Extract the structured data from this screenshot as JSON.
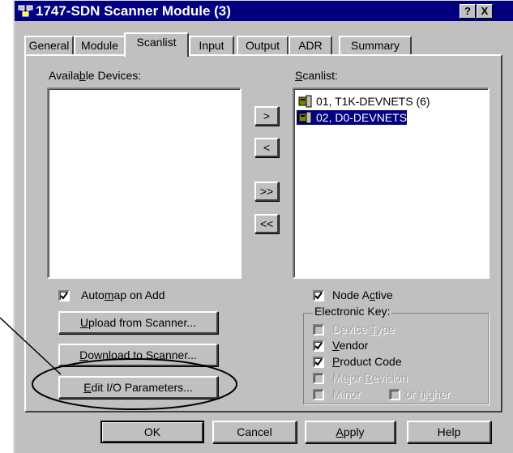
{
  "window": {
    "title": "1747-SDN Scanner Module (3)",
    "help_btn": "?",
    "close_btn": "X"
  },
  "tabs": [
    {
      "label": "General"
    },
    {
      "label": "Module"
    },
    {
      "label": "Scanlist",
      "active": true
    },
    {
      "label": "Input"
    },
    {
      "label": "Output"
    },
    {
      "label": "ADR"
    },
    {
      "label": "Summary"
    }
  ],
  "available": {
    "label_pre": "Availa",
    "label_u": "b",
    "label_post": "le Devices:"
  },
  "scanlist": {
    "label_u": "S",
    "label_post": "canlist:",
    "items": [
      "01, T1K-DEVNETS (6)",
      "02, D0-DEVNETS"
    ]
  },
  "transfer": {
    "add": ">",
    "remove": "<",
    "add_all": ">>",
    "remove_all": "<<"
  },
  "automap": {
    "pre": "Auto",
    "u": "m",
    "post": "ap on Add",
    "checked": true
  },
  "buttons": {
    "upload": {
      "u": "U",
      "post": "pload from Scanner..."
    },
    "download": {
      "u": "D",
      "post": "ownload to Scanner..."
    },
    "edit_io": {
      "u": "E",
      "post": "dit I/O Parameters..."
    }
  },
  "node_active": {
    "pre": "Node A",
    "u": "c",
    "post": "tive",
    "checked": true
  },
  "electronic_key": {
    "label": "Electronic Key:",
    "device_type": {
      "pre": "Device ",
      "u": "T",
      "post": "ype",
      "checked": false,
      "enabled": false
    },
    "vendor": {
      "pre": "",
      "u": "V",
      "post": "endor",
      "checked": true,
      "enabled": true
    },
    "product_code": {
      "pre": "",
      "u": "P",
      "post": "roduct Code",
      "checked": true,
      "enabled": true
    },
    "major_revision": {
      "pre": "Major ",
      "u": "R",
      "post": "evision",
      "checked": false,
      "enabled": false
    },
    "minor": {
      "text": "Minor",
      "checked": false,
      "enabled": false
    },
    "or_higher": {
      "pre": "or ",
      "u": "h",
      "post": "igher",
      "checked": false,
      "enabled": false
    }
  },
  "footer": {
    "ok": "OK",
    "cancel": "Cancel",
    "apply_u": "A",
    "apply_post": "pply",
    "help": "Help"
  },
  "colors": {
    "titlebar": "#000080",
    "dialog": "#c0c0c0",
    "selection": "#000080"
  }
}
